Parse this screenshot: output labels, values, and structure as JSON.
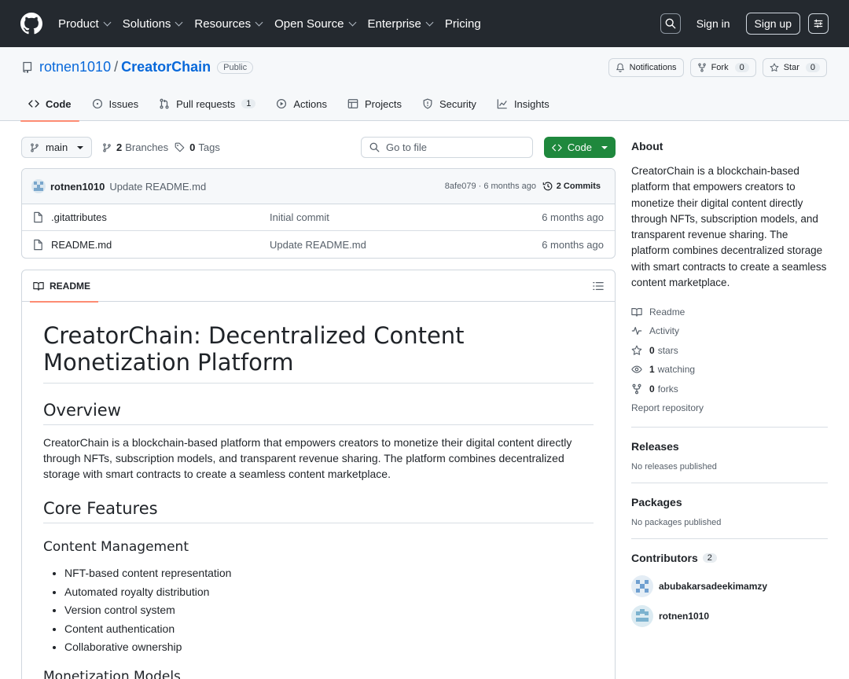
{
  "header": {
    "nav": [
      "Product",
      "Solutions",
      "Resources",
      "Open Source",
      "Enterprise",
      "Pricing"
    ],
    "sign_in": "Sign in",
    "sign_up": "Sign up"
  },
  "repo": {
    "owner": "rotnen1010",
    "name": "CreatorChain",
    "visibility": "Public",
    "notifications_label": "Notifications",
    "fork_label": "Fork",
    "fork_count": "0",
    "star_label": "Star",
    "star_count": "0"
  },
  "tabs": [
    {
      "label": "Code",
      "icon": "code-icon",
      "active": true
    },
    {
      "label": "Issues",
      "icon": "issue-icon"
    },
    {
      "label": "Pull requests",
      "icon": "pull-request-icon",
      "count": "1"
    },
    {
      "label": "Actions",
      "icon": "play-icon"
    },
    {
      "label": "Projects",
      "icon": "table-icon"
    },
    {
      "label": "Security",
      "icon": "shield-icon"
    },
    {
      "label": "Insights",
      "icon": "graph-icon"
    }
  ],
  "filenav": {
    "branch": "main",
    "branches_count": "2",
    "branches_label": "Branches",
    "tags_count": "0",
    "tags_label": "Tags",
    "go_to_file_placeholder": "Go to file",
    "code_button": "Code"
  },
  "latest_commit": {
    "author": "rotnen1010",
    "message": "Update README.md",
    "meta": "8afe079 · 6 months ago",
    "commits_label": "2 Commits"
  },
  "files": [
    {
      "name": ".gitattributes",
      "commit": "Initial commit",
      "age": "6 months ago"
    },
    {
      "name": "README.md",
      "commit": "Update README.md",
      "age": "6 months ago"
    }
  ],
  "readme": {
    "tab_label": "README",
    "h1": "CreatorChain: Decentralized Content Monetization Platform",
    "h2_overview": "Overview",
    "overview_text": "CreatorChain is a blockchain-based platform that empowers creators to monetize their digital content directly through NFTs, subscription models, and transparent revenue sharing. The platform combines decentralized storage with smart contracts to create a seamless content marketplace.",
    "h2_features": "Core Features",
    "h3_content": "Content Management",
    "content_items": [
      "NFT-based content representation",
      "Automated royalty distribution",
      "Version control system",
      "Content authentication",
      "Collaborative ownership"
    ],
    "h3_next": "Monetization Models"
  },
  "sidebar": {
    "about_title": "About",
    "about_text": "CreatorChain is a blockchain-based platform that empowers creators to monetize their digital content directly through NFTs, subscription models, and transparent revenue sharing. The platform combines decentralized storage with smart contracts to create a seamless content marketplace.",
    "links": [
      {
        "icon": "book-icon",
        "count": "",
        "label": "Readme"
      },
      {
        "icon": "pulse-icon",
        "count": "",
        "label": "Activity"
      },
      {
        "icon": "star-icon",
        "count": "0",
        "label": "stars"
      },
      {
        "icon": "eye-icon",
        "count": "1",
        "label": "watching"
      },
      {
        "icon": "fork-icon",
        "count": "0",
        "label": "forks"
      }
    ],
    "report": "Report repository",
    "releases_title": "Releases",
    "releases_text": "No releases published",
    "packages_title": "Packages",
    "packages_text": "No packages published",
    "contributors_title": "Contributors",
    "contributors_count": "2",
    "contributors": [
      "abubakarsadeekimamzy",
      "rotnen1010"
    ]
  }
}
